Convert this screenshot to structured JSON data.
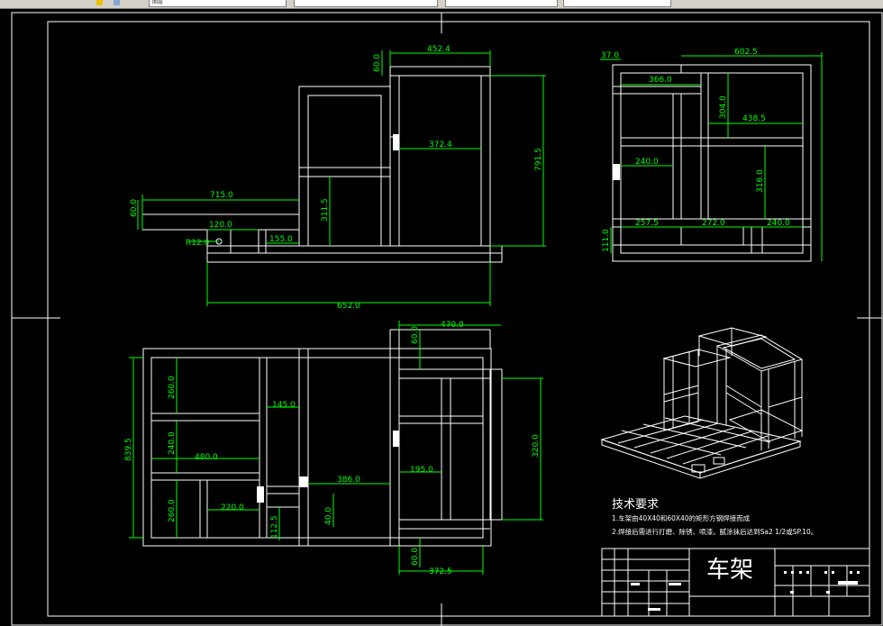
{
  "toolbar": {
    "layer_label": "图层"
  },
  "dimensions": {
    "front": {
      "top_width": "452.4",
      "top_rail": "60.0",
      "height_total": "791.5",
      "inner_width": "372.4",
      "step_height": "311.5",
      "arm_length": "715.0",
      "arm_height": "60.0",
      "arm_inner": "120.0",
      "radius": "R12.0",
      "foot": "155.0",
      "base_length": "652.0"
    },
    "side": {
      "offset": "37.0",
      "width": "602.5",
      "inner_top": "366.0",
      "height_a": "304.0",
      "inner_mid": "438.5",
      "left_gap": "240.0",
      "height_b": "316.0",
      "base_a": "257.5",
      "base_b": "272.0",
      "base_c": "240.0",
      "base_height": "111.0"
    },
    "plan": {
      "top_width": "470.0",
      "top_rail": "60.0",
      "row_a": "260.0",
      "rail_a": "145.0",
      "row_b": "240.0",
      "span": "480.0",
      "mid": "386.0",
      "inner": "195.0",
      "right_height": "320.0",
      "row_c": "260.0",
      "short": "220.0",
      "small_a": "40.0",
      "small_b": "112.5",
      "total_height": "839.5",
      "bottom_rail": "60.0",
      "bottom_width": "372.5"
    }
  },
  "notes": {
    "heading": "技术要求",
    "line1": "1.车架由40X40和60X40的矩形方钢焊接而成",
    "line2": "2.焊接后需进行打磨、除锈、喷漆。腻涂抹后达到Sa2 1/2或SP.10。"
  },
  "title_block": {
    "title": "车架"
  },
  "colors": {
    "line": "#ffffff",
    "dimension": "#00ff00",
    "background": "#000000",
    "toolbar": "#d4d0c8"
  }
}
